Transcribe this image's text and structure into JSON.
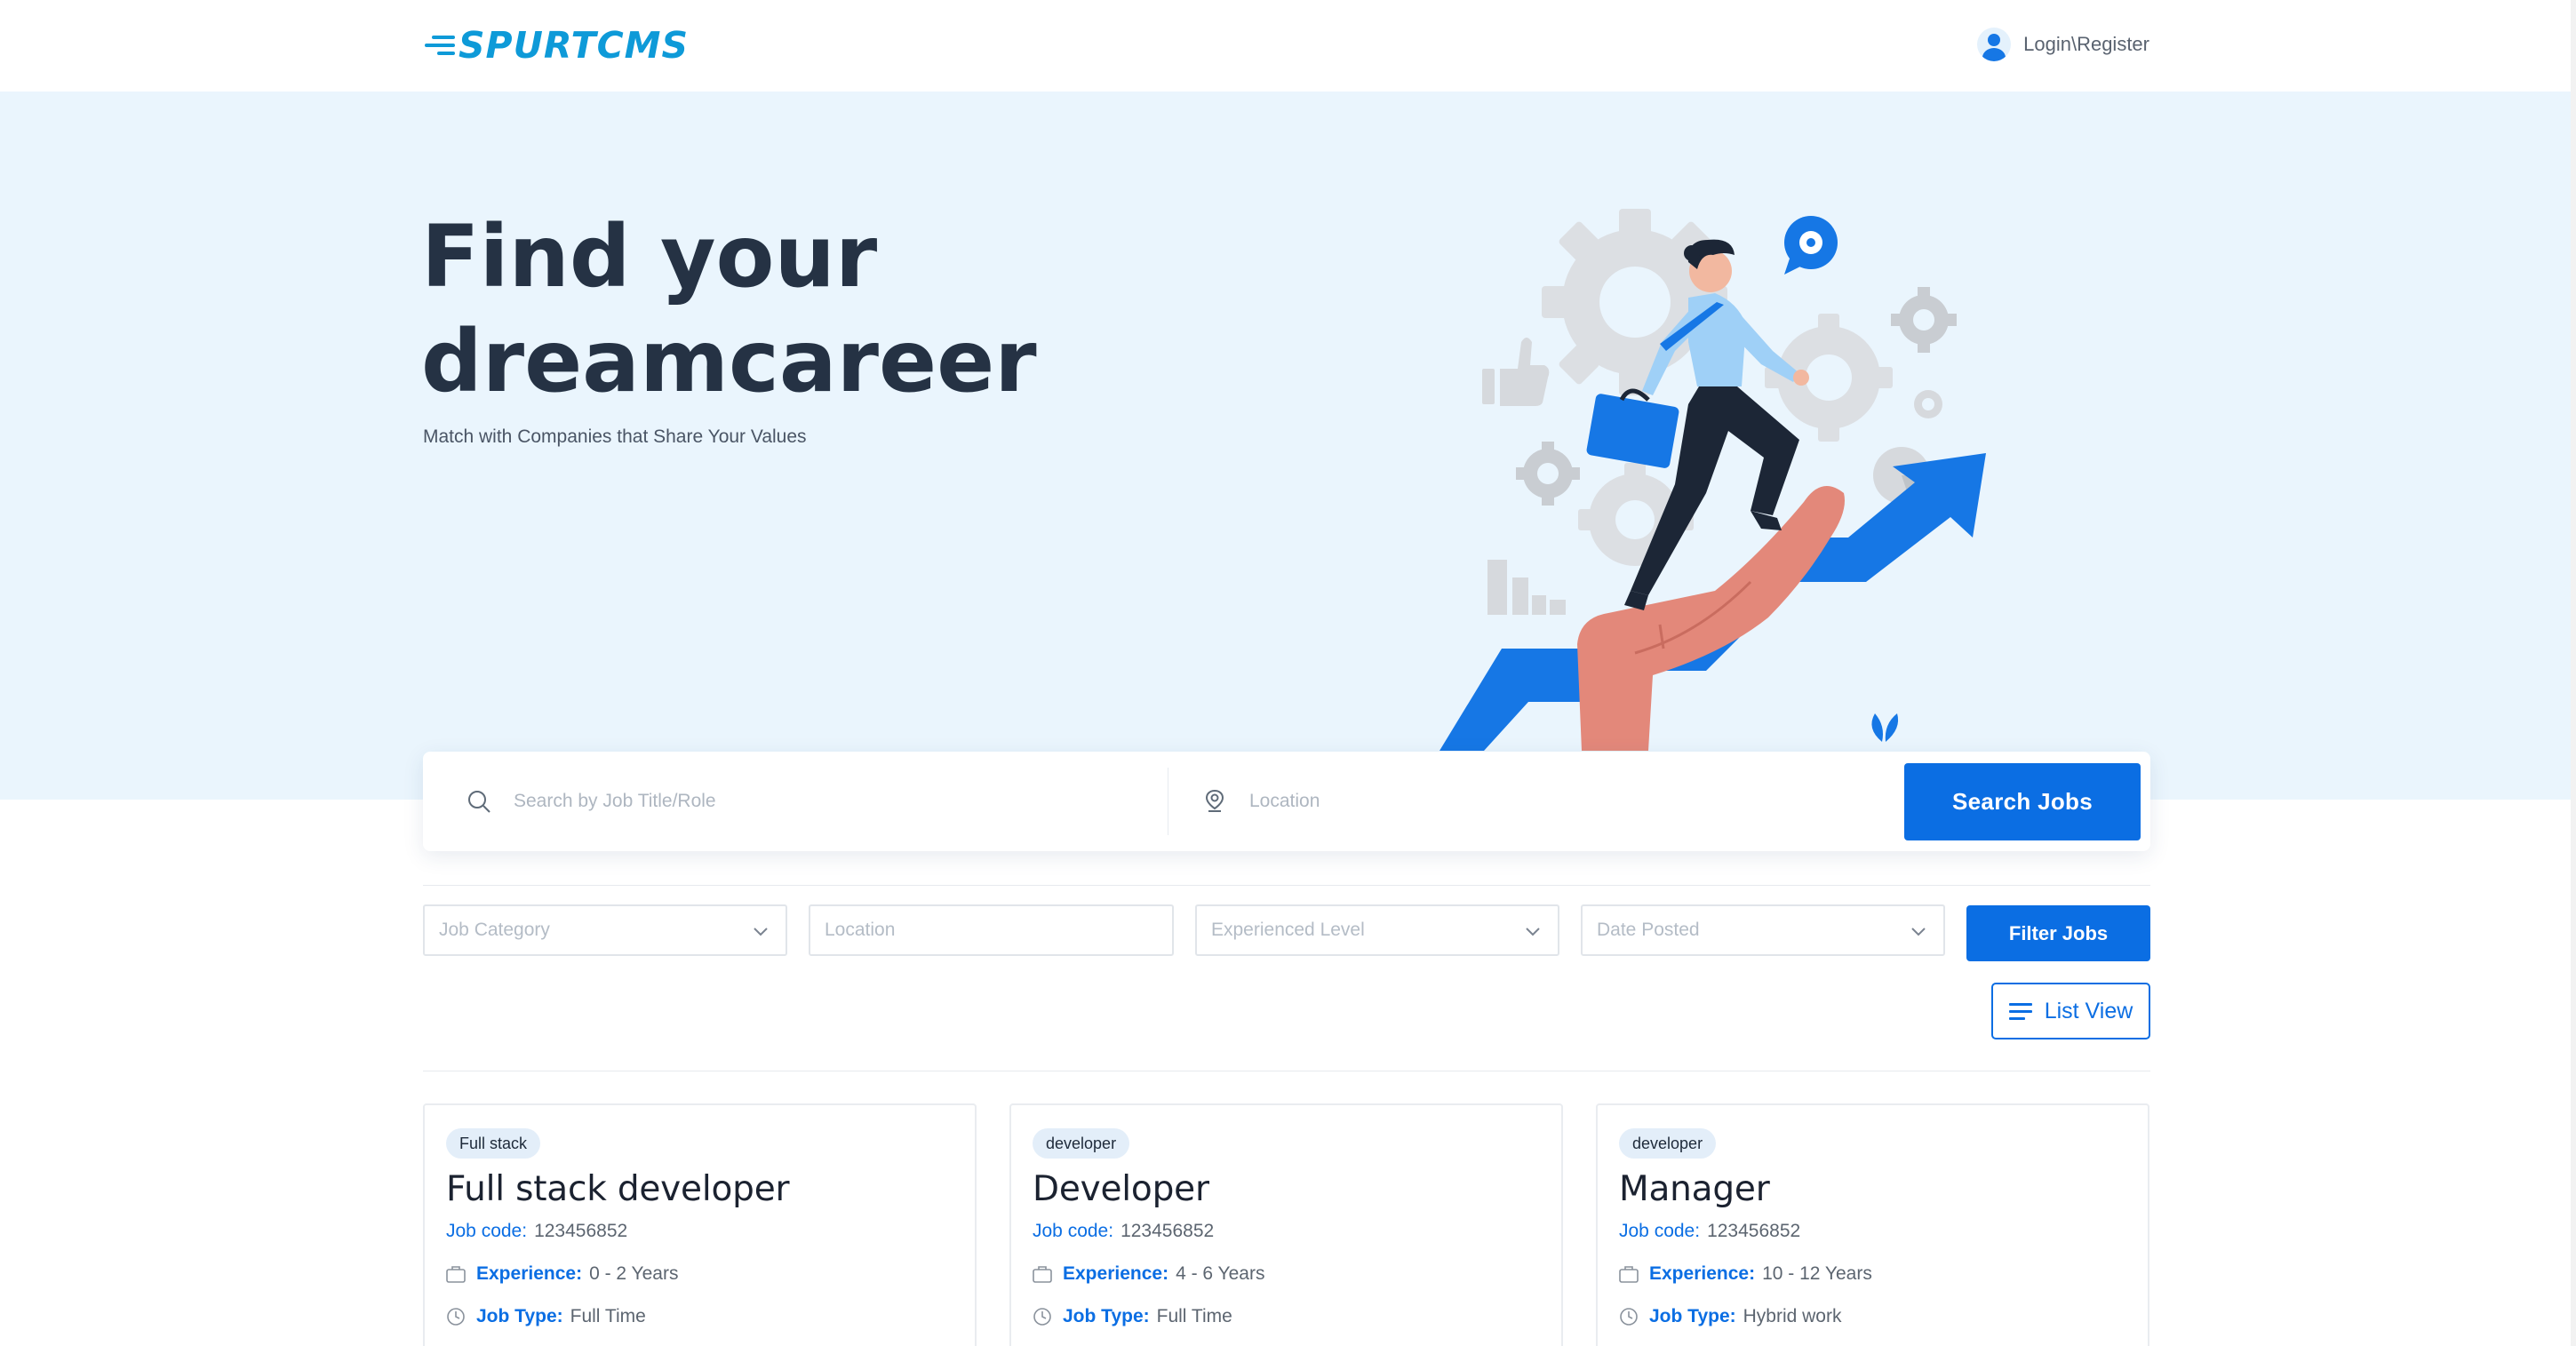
{
  "header": {
    "logo_text": "SPURTCMS",
    "login_label": "Login\\Register"
  },
  "hero": {
    "title_line1": "Find your",
    "title_line2": "dreamcareer",
    "subtitle": "Match with Companies that Share Your Values"
  },
  "search": {
    "job_placeholder": "Search by Job Title/Role",
    "location_placeholder": "Location",
    "button_label": "Search Jobs"
  },
  "filters": {
    "category_placeholder": "Job Category",
    "location_placeholder": "Location",
    "experience_placeholder": "Experienced Level",
    "date_placeholder": "Date Posted",
    "filter_button": "Filter Jobs",
    "view_button": "List View"
  },
  "jobs": [
    {
      "badge": "Full stack",
      "title": "Full stack developer",
      "code_label": "Job code:",
      "code": "123456852",
      "experience_label": "Experience:",
      "experience": "0 - 2 Years",
      "type_label": "Job Type:",
      "type": "Full Time"
    },
    {
      "badge": "developer",
      "title": "Developer",
      "code_label": "Job code:",
      "code": "123456852",
      "experience_label": "Experience:",
      "experience": "4 - 6 Years",
      "type_label": "Job Type:",
      "type": "Full Time"
    },
    {
      "badge": "developer",
      "title": "Manager",
      "code_label": "Job code:",
      "code": "123456852",
      "experience_label": "Experience:",
      "experience": "10 - 12 Years",
      "type_label": "Job Type:",
      "type": "Hybrid work"
    }
  ],
  "colors": {
    "primary": "#0b6ee3",
    "logo": "#0e9ad8",
    "hero_bg": "#eaf5fd",
    "heading": "#253244"
  }
}
